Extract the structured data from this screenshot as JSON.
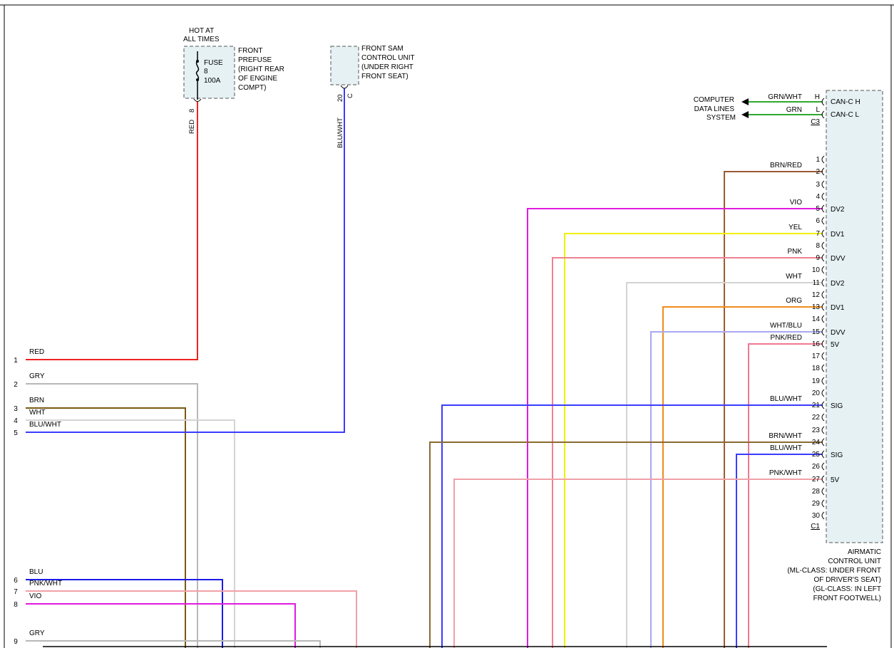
{
  "colors": {
    "RED": "#ee2222",
    "GRY": "#b8b8b8",
    "BRN": "#7a5a10",
    "WHT": "#d4d4d4",
    "BLU/WHT": "#3b3bff",
    "BLU": "#1a1ae6",
    "PNK/WHT": "#f0a0a8",
    "VIO": "#e01ce0",
    "GRN/WHT": "#2fa82f",
    "GRN": "#2fa82f",
    "BRN/RED": "#9a5a30",
    "YEL": "#f0f000",
    "PNK": "#f08090",
    "ORG": "#f08c1a",
    "WHT/BLU": "#a8a8f0",
    "PNK/RED": "#f07890",
    "BRN/WHT": "#8a6a30",
    "component_fill": "#e6f1f4"
  },
  "fuse_box": {
    "header": [
      "HOT AT",
      "ALL TIMES"
    ],
    "inner": [
      "FUSE",
      "8",
      "100A"
    ],
    "side": [
      "FRONT",
      "PREFUSE",
      "(RIGHT REAR",
      "OF ENGINE",
      "COMPT)"
    ],
    "pin": "8",
    "wire": "RED"
  },
  "sam_box": {
    "side": [
      "FRONT SAM",
      "CONTROL UNIT",
      "(UNDER RIGHT",
      "FRONT SEAT)"
    ],
    "pin": "20",
    "connector": "C",
    "wire": "BLU/WHT"
  },
  "data_lines": {
    "label": [
      "COMPUTER",
      "DATA LINES",
      "SYSTEM"
    ],
    "wires": [
      {
        "color": "GRN/WHT",
        "pin": "H",
        "name": "CAN-C H"
      },
      {
        "color": "GRN",
        "pin": "L",
        "name": "CAN-C L"
      }
    ],
    "connector": "C3"
  },
  "left_pins": [
    {
      "pin": "1",
      "color": "RED"
    },
    {
      "pin": "2",
      "color": "GRY"
    },
    {
      "pin": "3",
      "color": "BRN"
    },
    {
      "pin": "4",
      "color": "WHT"
    },
    {
      "pin": "5",
      "color": "BLU/WHT"
    },
    {
      "pin": "6",
      "color": "BLU"
    },
    {
      "pin": "7",
      "color": "PNK/WHT"
    },
    {
      "pin": "8",
      "color": "VIO"
    },
    {
      "pin": "9",
      "color": "GRY"
    }
  ],
  "right_pins": [
    {
      "pin": "1",
      "color": "",
      "name": ""
    },
    {
      "pin": "2",
      "color": "BRN/RED",
      "name": ""
    },
    {
      "pin": "3",
      "color": "",
      "name": ""
    },
    {
      "pin": "4",
      "color": "",
      "name": ""
    },
    {
      "pin": "5",
      "color": "VIO",
      "name": "DV2"
    },
    {
      "pin": "6",
      "color": "",
      "name": ""
    },
    {
      "pin": "7",
      "color": "YEL",
      "name": "DV1"
    },
    {
      "pin": "8",
      "color": "",
      "name": ""
    },
    {
      "pin": "9",
      "color": "PNK",
      "name": "DVV"
    },
    {
      "pin": "10",
      "color": "",
      "name": ""
    },
    {
      "pin": "11",
      "color": "WHT",
      "name": "DV2"
    },
    {
      "pin": "12",
      "color": "",
      "name": ""
    },
    {
      "pin": "13",
      "color": "ORG",
      "name": "DV1"
    },
    {
      "pin": "14",
      "color": "",
      "name": ""
    },
    {
      "pin": "15",
      "color": "WHT/BLU",
      "name": "DVV"
    },
    {
      "pin": "16",
      "color": "PNK/RED",
      "name": "5V"
    },
    {
      "pin": "17",
      "color": "",
      "name": ""
    },
    {
      "pin": "18",
      "color": "",
      "name": ""
    },
    {
      "pin": "19",
      "color": "",
      "name": ""
    },
    {
      "pin": "20",
      "color": "",
      "name": ""
    },
    {
      "pin": "21",
      "color": "BLU/WHT",
      "name": "SIG"
    },
    {
      "pin": "22",
      "color": "",
      "name": ""
    },
    {
      "pin": "23",
      "color": "",
      "name": ""
    },
    {
      "pin": "24",
      "color": "BRN/WHT",
      "name": ""
    },
    {
      "pin": "25",
      "color": "BLU/WHT",
      "name": "SIG"
    },
    {
      "pin": "26",
      "color": "",
      "name": ""
    },
    {
      "pin": "27",
      "color": "PNK/WHT",
      "name": "5V"
    },
    {
      "pin": "28",
      "color": "",
      "name": ""
    },
    {
      "pin": "29",
      "color": "",
      "name": ""
    },
    {
      "pin": "30",
      "color": "",
      "name": ""
    }
  ],
  "right_connector": "C1",
  "control_unit": {
    "label": [
      "AIRMATIC",
      "CONTROL UNIT",
      "(ML-CLASS: UNDER FRONT",
      "OF DRIVER'S SEAT)",
      "(GL-CLASS: IN LEFT",
      "FRONT FOOTWELL)"
    ]
  }
}
